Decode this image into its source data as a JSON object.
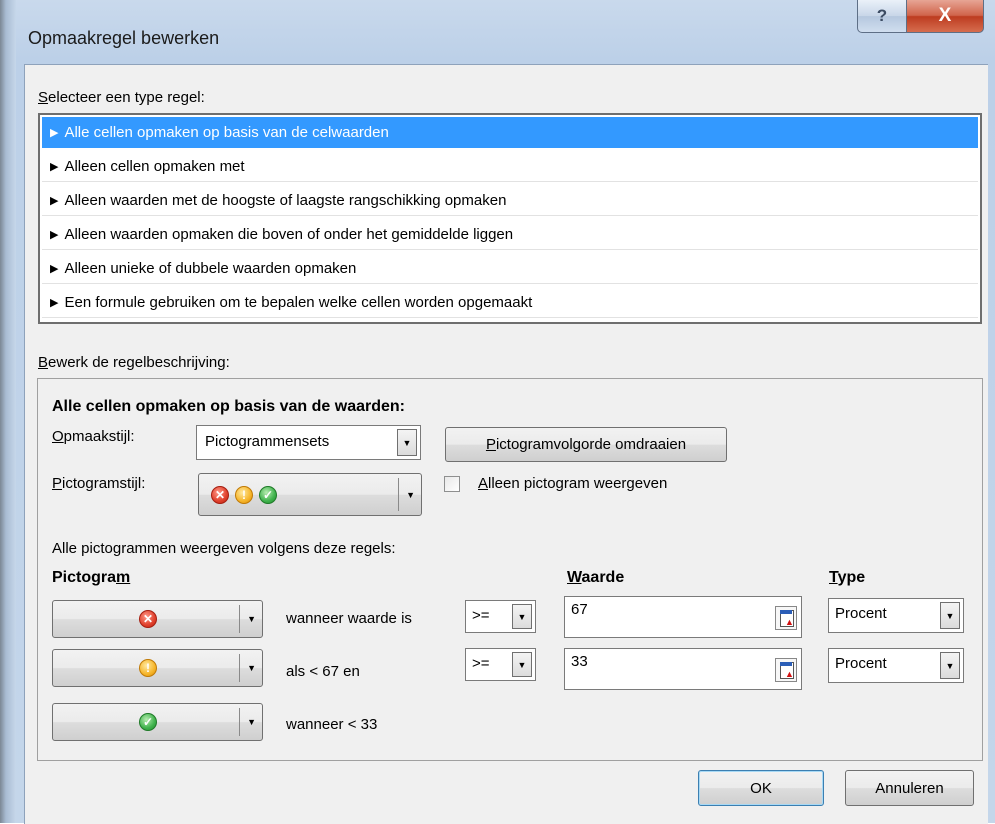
{
  "window": {
    "title": "Opmaakregel bewerken",
    "help_glyph": "?",
    "close_glyph": "X"
  },
  "rule_type": {
    "label_u": "S",
    "label_rest": "electeer een type regel:",
    "items": [
      {
        "label": "Alle cellen opmaken op basis van de celwaarden",
        "selected": true
      },
      {
        "label": "Alleen cellen opmaken met",
        "selected": false
      },
      {
        "label": "Alleen waarden met de hoogste of laagste rangschikking opmaken",
        "selected": false
      },
      {
        "label": "Alleen waarden opmaken die boven of onder het gemiddelde liggen",
        "selected": false
      },
      {
        "label": "Alleen unieke of dubbele waarden opmaken",
        "selected": false
      },
      {
        "label": "Een formule gebruiken om te bepalen welke cellen worden opgemaakt",
        "selected": false
      }
    ]
  },
  "description": {
    "label_u": "B",
    "label_rest": "ewerk de regelbeschrijving:",
    "heading": "Alle cellen opmaken op basis van de waarden:",
    "format_style_label_u": "O",
    "format_style_label_rest": "pmaakstijl:",
    "format_style_value": "Pictogrammensets",
    "reverse_button_u": "P",
    "reverse_button_rest": "ictogramvolgorde omdraaien",
    "icon_style_label_u": "P",
    "icon_style_label_rest": "ictogramstijl:",
    "icon_style_icons": [
      "red-x-icon",
      "yellow-exclamation-icon",
      "green-check-icon"
    ],
    "show_icon_only_u": "A",
    "show_icon_only_rest": "lleen pictogram weergeven",
    "show_icon_only_checked": false,
    "rules_intro": "Alle pictogrammen weergeven volgens deze regels:",
    "col_icon_a": "Pictogra",
    "col_icon_u": "m",
    "col_value_u": "W",
    "col_value_rest": "aarde",
    "col_type_u": "T",
    "col_type_rest": "ype",
    "rows": [
      {
        "icon": "red-x-icon",
        "condition": "wanneer waarde is",
        "operator": ">=",
        "value": "67",
        "type": "Procent"
      },
      {
        "icon": "yellow-exclamation-icon",
        "condition": "als < 67 en",
        "operator": ">=",
        "value": "33",
        "type": "Procent"
      },
      {
        "icon": "green-check-icon",
        "condition": "wanneer < 33"
      }
    ]
  },
  "footer": {
    "ok": "OK",
    "cancel": "Annuleren"
  },
  "colors": {
    "selection": "#3399ff",
    "icon_red": "#e0402c",
    "icon_yellow": "#f6b52a",
    "icon_green": "#3fb24c"
  }
}
